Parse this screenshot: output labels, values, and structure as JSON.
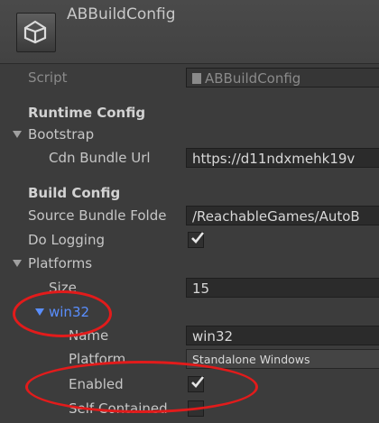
{
  "header": {
    "title": "ABBuildConfig"
  },
  "script": {
    "label": "Script",
    "value": "ABBuildConfig"
  },
  "runtime_config": {
    "heading": "Runtime Config",
    "bootstrap": {
      "label": "Bootstrap",
      "cdn_bundle_url": {
        "label": "Cdn Bundle Url",
        "value": "https://d11ndxmehk19v"
      }
    }
  },
  "build_config": {
    "heading": "Build Config",
    "source_bundle_folder": {
      "label": "Source Bundle Folde",
      "value": "/ReachableGames/AutoB"
    },
    "do_logging": {
      "label": "Do Logging",
      "checked": true
    },
    "platforms": {
      "label": "Platforms",
      "size": {
        "label": "Size",
        "value": "15"
      },
      "element": {
        "label": "win32",
        "name": {
          "label": "Name",
          "value": "win32"
        },
        "platform": {
          "label": "Platform",
          "value": "Standalone Windows"
        },
        "enabled": {
          "label": "Enabled",
          "checked": true
        },
        "self_contained": {
          "label": "Self Contained",
          "checked": false
        }
      }
    }
  },
  "annotation_color": "#e21b1b"
}
